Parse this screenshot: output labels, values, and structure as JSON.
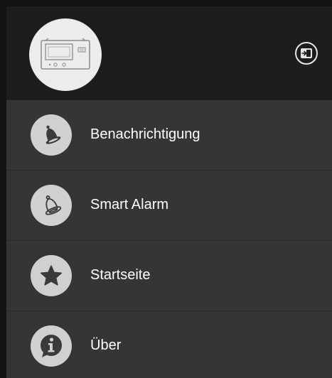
{
  "drawer": {
    "header": {
      "avatar_icon": "device-icon",
      "switch_icon": "switch-device-icon"
    },
    "menu_items": [
      {
        "label": "Benachrichtigung",
        "icon": "bell-filled-icon"
      },
      {
        "label": "Smart Alarm",
        "icon": "bell-outline-icon"
      },
      {
        "label": "Startseite",
        "icon": "star-icon"
      },
      {
        "label": "Über",
        "icon": "info-icon"
      }
    ]
  },
  "colors": {
    "header_bg": "#1d1d1d",
    "menu_bg": "#353535",
    "icon_circle": "#d0d0d0",
    "icon_fg": "#3a3a3a",
    "text": "#ffffff"
  }
}
